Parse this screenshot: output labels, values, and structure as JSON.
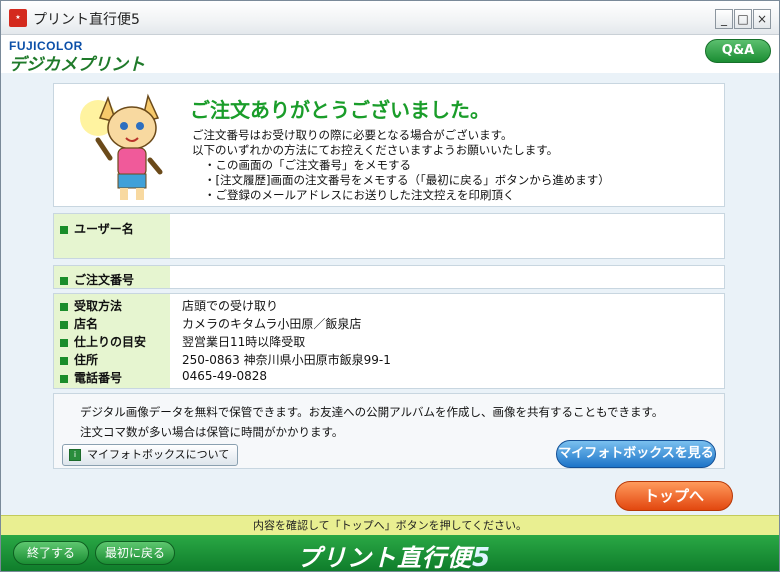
{
  "window": {
    "title": "プリント直行便5",
    "controls": [
      "_",
      "□",
      "×"
    ]
  },
  "header": {
    "logo_top": "FUJICOLOR",
    "logo_main": "デジカメプリント",
    "qa_label": "Q&A"
  },
  "thanks": {
    "title": "ご注文ありがとうございました。",
    "line1": "ご注文番号はお受け取りの際に必要となる場合がございます。",
    "line2": "以下のいずれかの方法にてお控えくださいますようお願いいたします。",
    "bullet1": "・この画面の「ご注文番号」をメモする",
    "bullet2": "・[注文履歴]画面の注文番号をメモする（「最初に戻る」ボタンから進めます）",
    "bullet3": "・ご登録のメールアドレスにお送りした注文控えを印刷頂く"
  },
  "user": {
    "label": "ユーザー名",
    "value": ""
  },
  "order": {
    "label": "ご注文番号",
    "value": ""
  },
  "details": {
    "rows": [
      {
        "label": "受取方法",
        "value": "店頭での受け取り"
      },
      {
        "label": "店名",
        "value": "カメラのキタムラ小田原／飯泉店"
      },
      {
        "label": "仕上りの目安",
        "value": "翌営業日11時以降受取"
      },
      {
        "label": "住所",
        "value": "250-0863 神奈川県小田原市飯泉99-1"
      },
      {
        "label": "電話番号",
        "value": "0465-49-0828"
      }
    ]
  },
  "photobox": {
    "text1": "デジタル画像データを無料で保管できます。お友達への公開アルバムを作成し、画像を共有することもできます。",
    "text2": "注文コマ数が多い場合は保管に時間がかかります。",
    "about_label": "マイフォトボックスについて",
    "view_label": "マイフォトボックスを見る"
  },
  "top_button": "トップへ",
  "status": "内容を確認して「トップへ」ボタンを押してください。",
  "footer": {
    "quit_label": "終了する",
    "restart_label": "最初に戻る",
    "brand_text": "プリント直行便",
    "brand_num": "5"
  }
}
